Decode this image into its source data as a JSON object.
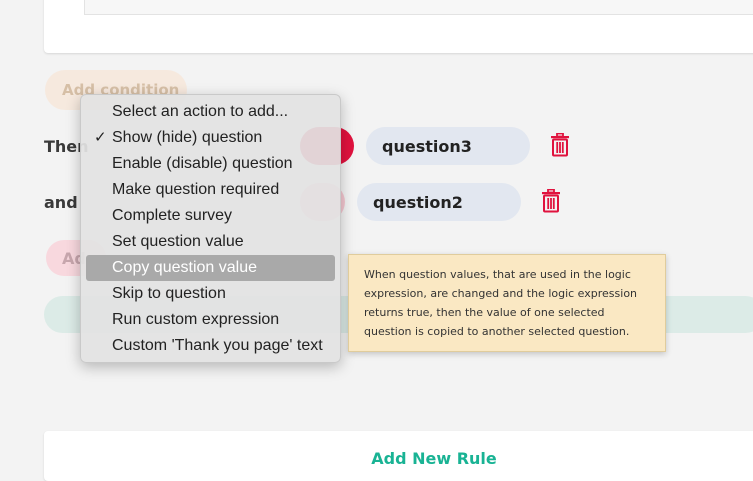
{
  "add_condition_label": "Add condition",
  "then_label": "Then",
  "and_label": "and",
  "action_rows": [
    {
      "question": "question3"
    },
    {
      "question": "question2"
    }
  ],
  "add_action_label": "Ad",
  "add_new_rule_label": "Add New Rule",
  "dropdown": {
    "items": [
      {
        "label": "Select an action to add...",
        "checked": false,
        "selected": false
      },
      {
        "label": "Show (hide) question",
        "checked": true,
        "selected": false
      },
      {
        "label": "Enable (disable) question",
        "checked": false,
        "selected": false
      },
      {
        "label": "Make question required",
        "checked": false,
        "selected": false
      },
      {
        "label": "Complete survey",
        "checked": false,
        "selected": false
      },
      {
        "label": "Set question value",
        "checked": false,
        "selected": false
      },
      {
        "label": "Copy question value",
        "checked": false,
        "selected": true
      },
      {
        "label": "Skip to question",
        "checked": false,
        "selected": false
      },
      {
        "label": "Run custom expression",
        "checked": false,
        "selected": false
      },
      {
        "label": "Custom 'Thank you page' text",
        "checked": false,
        "selected": false
      }
    ],
    "checkmark": "✓"
  },
  "tooltip_text": "When question values, that are used in the logic expression, are changed and the logic expression returns true, then the value of one selected question is copied to another selected question.",
  "icons": {
    "delete": "trash-icon",
    "check": "checkmark-icon"
  },
  "colors": {
    "accent": "#19b394",
    "danger": "#e0123e",
    "selected_bg": "#a9a9a9"
  }
}
